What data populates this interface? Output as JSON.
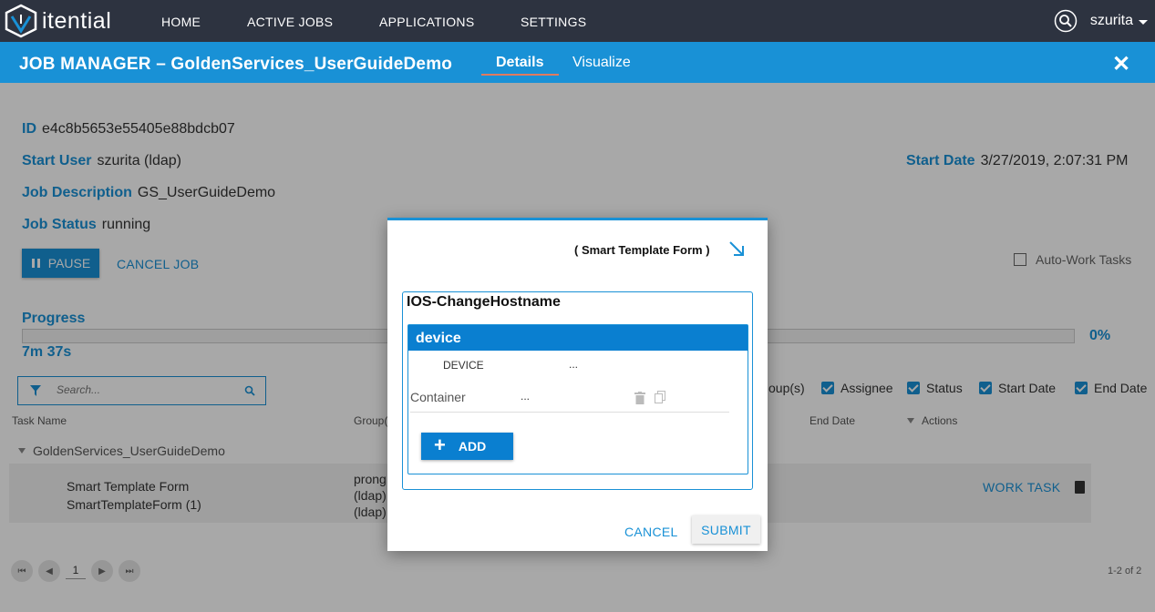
{
  "nav": {
    "logo_text": "itential",
    "items": [
      "HOME",
      "ACTIVE JOBS",
      "APPLICATIONS",
      "SETTINGS"
    ],
    "user": "szurita"
  },
  "header": {
    "title": "JOB MANAGER – GoldenServices_UserGuideDemo",
    "tabs": [
      "Details",
      "Visualize"
    ],
    "active_tab": "Details"
  },
  "job": {
    "id_label": "ID",
    "id_value": "e4c8b5653e55405e88bdcb07",
    "start_user_label": "Start User",
    "start_user_value": "szurita (ldap)",
    "description_label": "Job Description",
    "description_value": "GS_UserGuideDemo",
    "status_label": "Job Status",
    "status_value": "running",
    "start_date_label": "Start Date",
    "start_date_value": "3/27/2019, 2:07:31 PM"
  },
  "actions": {
    "pause_label": "PAUSE",
    "cancel_label": "CANCEL JOB",
    "auto_work_label": "Auto-Work Tasks"
  },
  "progress": {
    "label": "Progress",
    "percent_text": "0%",
    "fraction": 0,
    "elapsed": "7m 37s"
  },
  "filter": {
    "search_placeholder": "Search...",
    "columns": [
      {
        "label": "oup(s)",
        "checked": false
      },
      {
        "label": "Assignee",
        "checked": true
      },
      {
        "label": "Status",
        "checked": true
      },
      {
        "label": "Start Date",
        "checked": true
      },
      {
        "label": "End Date",
        "checked": true
      }
    ]
  },
  "table": {
    "headers": {
      "task_name": "Task Name",
      "group": "Group(",
      "end_date": "End Date",
      "actions": "Actions"
    },
    "group_name": "GoldenServices_UserGuideDemo",
    "row": {
      "name_line1": "Smart Template Form",
      "name_line2": "SmartTemplateForm (1)",
      "group_lines": [
        "prong",
        "(ldap)",
        "(ldap)"
      ],
      "action_label": "WORK TASK"
    },
    "pager": {
      "page": "1",
      "count_text": "1-2 of 2"
    }
  },
  "modal": {
    "title": "( Smart Template Form )",
    "form_name": "IOS-ChangeHostname",
    "section": "device",
    "device_label": "DEVICE",
    "device_value": "...",
    "container_label": "Container",
    "container_value": "...",
    "add_label": "ADD",
    "cancel_label": "CANCEL",
    "submit_label": "SUBMIT"
  },
  "colors": {
    "accent": "#1991d6",
    "nav_bg": "#2d3340",
    "section_head": "#0a7fd0"
  }
}
